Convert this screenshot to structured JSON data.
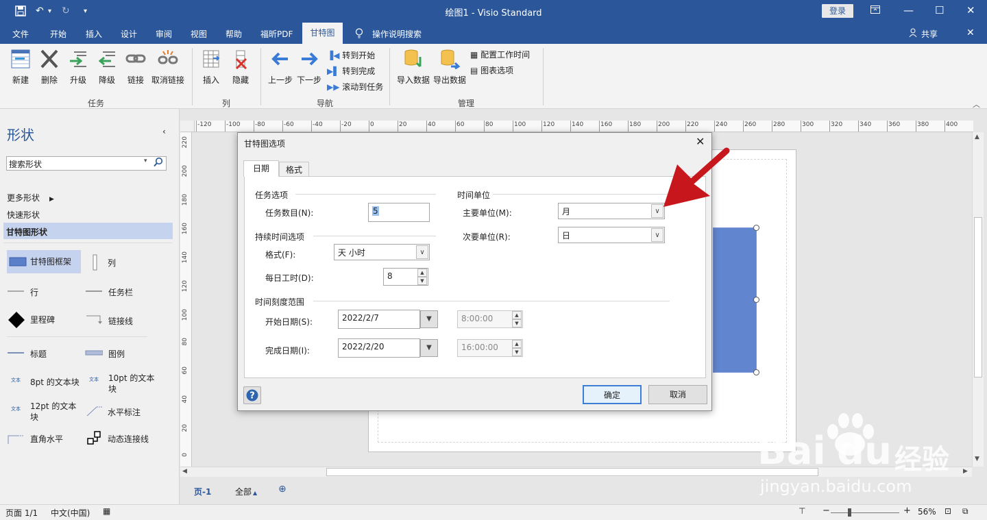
{
  "window": {
    "title": "绘图1  -  Visio Standard",
    "login_label": "登录"
  },
  "menu": {
    "items": [
      "文件",
      "开始",
      "插入",
      "设计",
      "审阅",
      "视图",
      "帮助",
      "福昕PDF"
    ],
    "active": "甘特图",
    "search": "操作说明搜索",
    "share": "共享"
  },
  "ribbon": {
    "task_group": {
      "label": "任务",
      "buttons": [
        "新建",
        "删除",
        "升级",
        "降级",
        "链接",
        "取消链接"
      ]
    },
    "column_group": {
      "label": "列",
      "buttons": [
        "插入",
        "隐藏"
      ]
    },
    "nav_group": {
      "label": "导航",
      "prev": "上一步",
      "next": "下一步",
      "goto_start": "转到开始",
      "goto_finish": "转到完成",
      "scroll_task": "滚动到任务"
    },
    "manage_group": {
      "label": "管理",
      "import": "导入数据",
      "export": "导出数据",
      "config_time": "配置工作时间",
      "chart_options": "图表选项"
    }
  },
  "shapes_panel": {
    "title": "形状",
    "search_placeholder": "搜索形状",
    "more_shapes": "更多形状",
    "quick_shapes": "快速形状",
    "active_stencil": "甘特图形状",
    "shapes": [
      "甘特图框架",
      "列",
      "行",
      "任务栏",
      "里程碑",
      "链接线",
      "标题",
      "图例",
      "8pt 的文本块",
      "10pt 的文本块",
      "12pt 的文本块",
      "水平标注",
      "直角水平",
      "动态连接线"
    ]
  },
  "ruler": {
    "h_ticks": [
      "120",
      "100",
      "80",
      "60",
      "40",
      "20",
      "0",
      "20",
      "40",
      "60",
      "80",
      "100",
      "120",
      "140",
      "160",
      "180",
      "200",
      "220",
      "240",
      "260",
      "280",
      "300",
      "320",
      "340",
      "360",
      "380",
      "400"
    ],
    "v_ticks": [
      "220",
      "200",
      "180",
      "160",
      "140",
      "120",
      "100",
      "80",
      "60",
      "40",
      "20",
      "0"
    ]
  },
  "page_tabs": {
    "current": "页-1",
    "all": "全部"
  },
  "status": {
    "page": "页面 1/1",
    "lang": "中文(中国)",
    "zoom": "56%"
  },
  "dialog": {
    "title": "甘特图选项",
    "tabs": [
      "日期",
      "格式"
    ],
    "task_options": "任务选项",
    "task_count_label": "任务数目(N):",
    "task_count_value": "5",
    "duration_options": "持续时间选项",
    "format_label": "格式(F):",
    "format_value": "天 小时",
    "hours_label": "每日工时(D):",
    "hours_value": "8",
    "time_units": "时间单位",
    "major_label": "主要单位(M):",
    "major_value": "月",
    "minor_label": "次要单位(R):",
    "minor_value": "日",
    "timescale": "时间刻度范围",
    "start_label": "开始日期(S):",
    "start_date": "2022/2/7",
    "start_time": "8:00:00",
    "finish_label": "完成日期(I):",
    "finish_date": "2022/2/20",
    "finish_time": "16:00:00",
    "ok": "确定",
    "cancel": "取消"
  },
  "watermark": {
    "brand": "Bai",
    "brand2": "du",
    "cn": "经验",
    "url": "jingyan.baidu.com"
  },
  "colors": {
    "accent": "#2b579a",
    "bar": "#6185cf",
    "arrow": "#c8161d"
  }
}
